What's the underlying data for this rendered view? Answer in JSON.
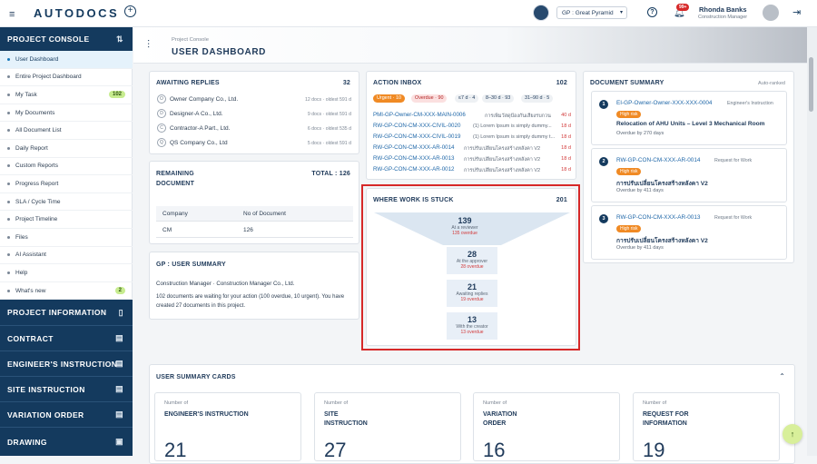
{
  "brand": {
    "logo_text": "AUTODOCS"
  },
  "topbar": {
    "project_select": "GP : Great Pyramid",
    "notif_count": "99+",
    "user_name": "Rhonda Banks",
    "user_role": "Construction Manager"
  },
  "sidebar": {
    "console_title": "PROJECT CONSOLE",
    "items": [
      {
        "label": "User Dashboard",
        "active": true
      },
      {
        "label": "Entire Project Dashboard"
      },
      {
        "label": "My Task",
        "badge": "102"
      },
      {
        "label": "My Documents"
      },
      {
        "label": "All Document List"
      },
      {
        "label": "Daily Report"
      },
      {
        "label": "Custom Reports"
      },
      {
        "label": "Progress Report"
      },
      {
        "label": "SLA / Cycle Time"
      },
      {
        "label": "Project Timeline"
      },
      {
        "label": "Files"
      },
      {
        "label": "AI Assistant"
      },
      {
        "label": "Help"
      },
      {
        "label": "What's new",
        "badge": "2"
      }
    ],
    "sections": [
      "PROJECT INFORMATION",
      "CONTRACT",
      "ENGINEER'S INSTRUCTION",
      "SITE INSTRUCTION",
      "VARIATION ORDER",
      "DRAWING"
    ]
  },
  "header": {
    "breadcrumb": "Project Console",
    "title": "USER DASHBOARD"
  },
  "awaiting": {
    "title": "AWAITING REPLIES",
    "count": "32",
    "rows": [
      {
        "initial": "O",
        "name": "Owner Company Co., Ltd.",
        "meta": "12 docs · oldest 591 d"
      },
      {
        "initial": "D",
        "name": "Designer-A Co., Ltd.",
        "meta": "9 docs · oldest 591 d"
      },
      {
        "initial": "C",
        "name": "Contractor-A Part., Ltd.",
        "meta": "6 docs · oldest 535 d"
      },
      {
        "initial": "Q",
        "name": "QS Company Co., Ltd",
        "meta": "5 docs · oldest 591 d"
      }
    ]
  },
  "remaining": {
    "title_line1": "REMAINING",
    "title_line2": "DOCUMENT",
    "total": "TOTAL : 126",
    "col1": "Company",
    "col2": "No of Document",
    "rows": [
      {
        "company": "CM",
        "count": "126"
      }
    ]
  },
  "gp_summary": {
    "title": "GP : USER SUMMARY",
    "line1": "Construction Manager · Construction Manager Co., Ltd.",
    "line2": "102 documents are waiting for your action (100 overdue, 10 urgent). You have created 27 documents in this project."
  },
  "inbox": {
    "title": "ACTION INBOX",
    "count": "102",
    "chips": [
      "Urgent · 10",
      "Overdue · 90",
      "≤7 d · 4",
      "8–30 d · 93",
      "31–90 d · 5"
    ],
    "rows": [
      {
        "code": "PMI-GP-Owner-CM-XXX-MAIN-0006",
        "desc": "การเพิ่มวัสดุป้องกันเสียงรบกวน",
        "days": "40 d"
      },
      {
        "code": "RW-GP-CON-CM-XXX-CIVIL-0020",
        "desc": "(1) Lorem Ipsum is simply dummy...",
        "days": "18 d"
      },
      {
        "code": "RW-GP-CON-CM-XXX-CIVIL-0019",
        "desc": "(1) Lorem Ipsum is simply dummy t...",
        "days": "18 d"
      },
      {
        "code": "RW-GP-CON-CM-XXX-AR-0014",
        "desc": "การปรับเปลี่ยนโครงสร้างหลังคา V2",
        "days": "18 d"
      },
      {
        "code": "RW-GP-CON-CM-XXX-AR-0013",
        "desc": "การปรับเปลี่ยนโครงสร้างหลังคา V2",
        "days": "18 d"
      },
      {
        "code": "RW-GP-CON-CM-XXX-AR-0012",
        "desc": "การปรับเปลี่ยนโครงสร้างหลังคา V2",
        "days": "18 d"
      }
    ]
  },
  "stuck": {
    "title": "WHERE WORK IS STUCK",
    "count": "201",
    "stages": [
      {
        "num": "139",
        "label": "At a reviewer",
        "overdue": "135 overdue"
      },
      {
        "num": "28",
        "label": "At the approver",
        "overdue": "28 overdue"
      },
      {
        "num": "21",
        "label": "Awaiting replies",
        "overdue": "19 overdue"
      },
      {
        "num": "13",
        "label": "With the creator",
        "overdue": "13 overdue"
      }
    ]
  },
  "doc_summary": {
    "title": "DOCUMENT SUMMARY",
    "auto": "Auto-ranked",
    "items": [
      {
        "n": "1",
        "code": "EI-GP-Owner-Owner-XXX-XXX-0004",
        "type": "Engineer's Instruction",
        "risk": "High risk",
        "name": "Relocation of AHU Units – Level 3 Mechanical Room",
        "overdue": "Overdue by 270 days"
      },
      {
        "n": "2",
        "code": "RW-GP-CON-CM-XXX-AR-0014",
        "type": "Request for Work",
        "risk": "High risk",
        "name": "การปรับเปลี่ยนโครงสร้างหลังคา V2",
        "overdue": "Overdue by 411 days"
      },
      {
        "n": "3",
        "code": "RW-GP-CON-CM-XXX-AR-0013",
        "type": "Request for Work",
        "risk": "High risk",
        "name": "การปรับเปลี่ยนโครงสร้างหลังคา V2",
        "overdue": "Overdue by 411 days"
      }
    ]
  },
  "user_cards": {
    "title": "USER SUMMARY CARDS",
    "cards": [
      {
        "small": "Number of",
        "label": "ENGINEER'S INSTRUCTION",
        "value": "21"
      },
      {
        "small": "Number of",
        "label": "SITE INSTRUCTION",
        "value": "27"
      },
      {
        "small": "Number of",
        "label": "VARIATION ORDER",
        "value": "16"
      },
      {
        "small": "Number of",
        "label": "REQUEST FOR INFORMATION",
        "value": "19"
      }
    ]
  },
  "colors": {
    "navy": "#143a5e",
    "accent_red": "#d23a3a",
    "highlight": "#d62828",
    "orange": "#f08a24"
  }
}
